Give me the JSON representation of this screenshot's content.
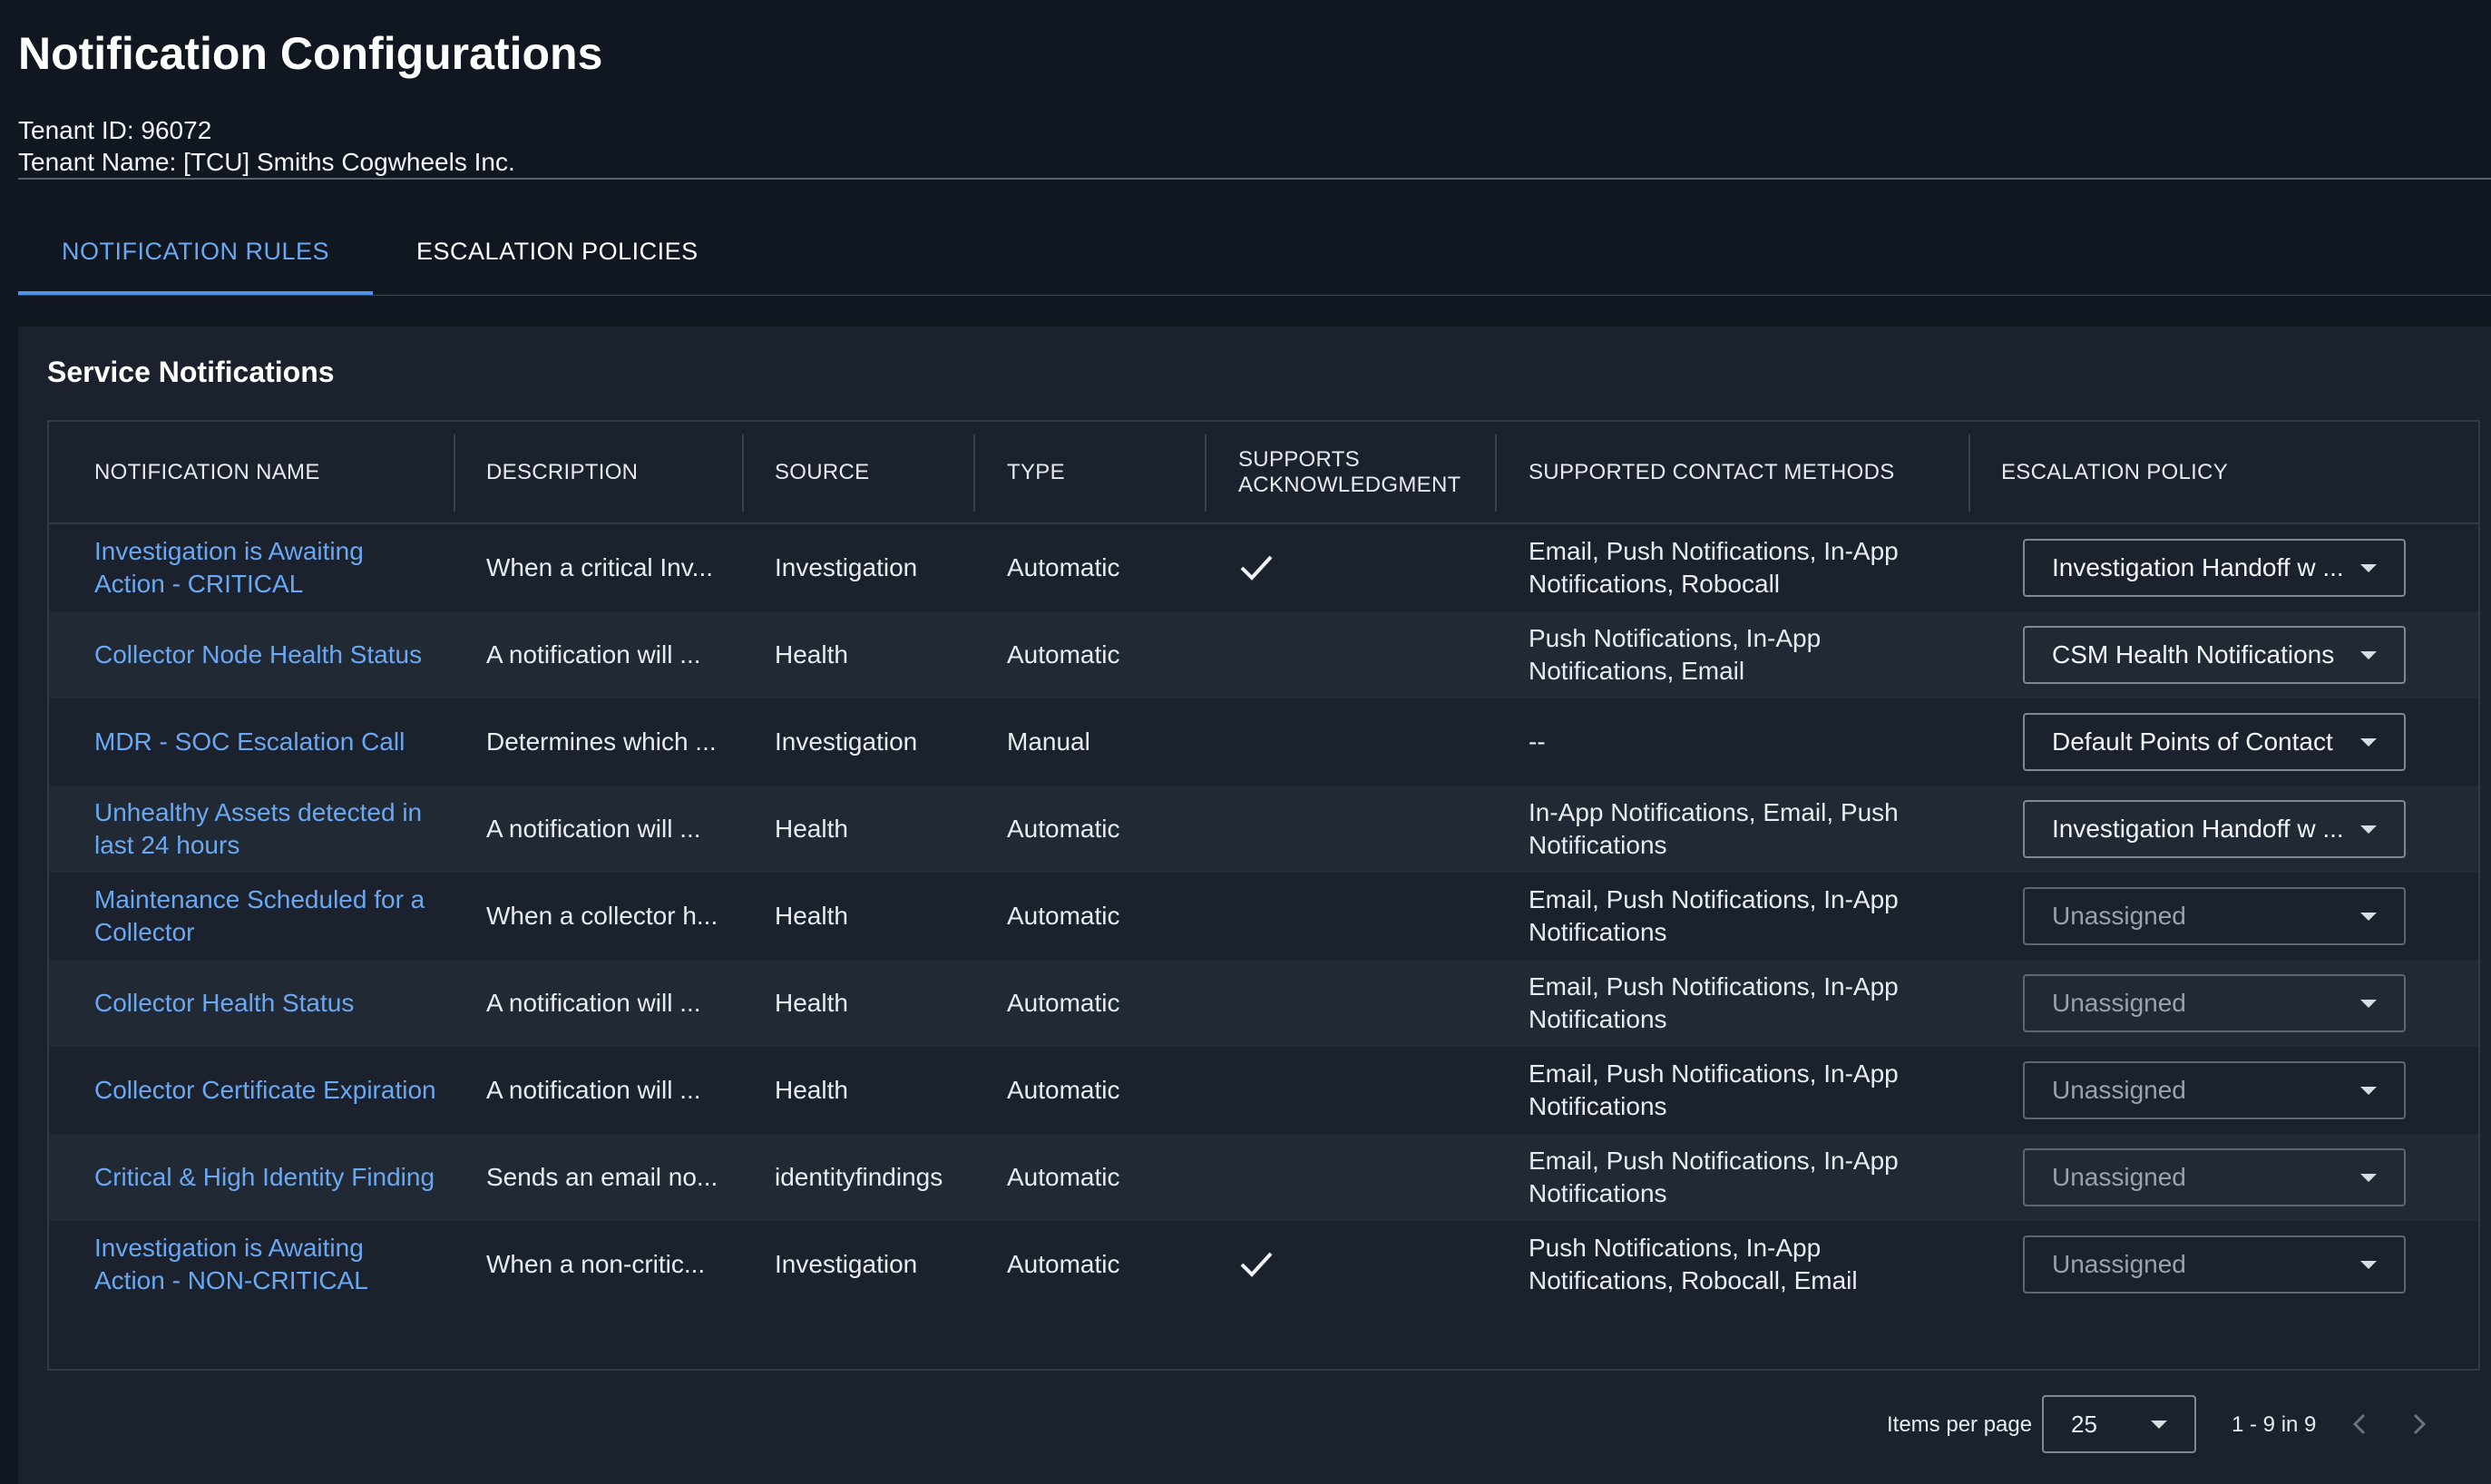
{
  "header": {
    "title": "Notification Configurations",
    "tenant_id": "Tenant ID: 96072",
    "tenant_name": "Tenant Name: [TCU] Smiths Cogwheels Inc."
  },
  "tabs": [
    {
      "label": "NOTIFICATION RULES",
      "active": true
    },
    {
      "label": "ESCALATION POLICIES",
      "active": false
    }
  ],
  "panel": {
    "title": "Service Notifications"
  },
  "table": {
    "columns": {
      "name": "NOTIFICATION NAME",
      "description": "DESCRIPTION",
      "source": "SOURCE",
      "type": "TYPE",
      "ack_line1": "SUPPORTS",
      "ack_line2": "ACKNOWLEDGMENT",
      "contact": "SUPPORTED CONTACT METHODS",
      "escalation": "ESCALATION POLICY"
    },
    "rows": [
      {
        "name": "Investigation is Awaiting Action - CRITICAL",
        "description": "When a critical Inv...",
        "source": "Investigation",
        "type": "Automatic",
        "ack": true,
        "contact": "Email, Push Notifications, In-App Notifications, Robocall",
        "escalation": "Investigation Handoff w ...",
        "assigned": true
      },
      {
        "name": "Collector Node Health Status",
        "description": "A notification will ...",
        "source": "Health",
        "type": "Automatic",
        "ack": false,
        "contact": "Push Notifications, In-App Notifications, Email",
        "escalation": "CSM Health Notifications",
        "assigned": true
      },
      {
        "name": "MDR - SOC Escalation Call",
        "description": "Determines which ...",
        "source": "Investigation",
        "type": "Manual",
        "ack": false,
        "contact": "--",
        "escalation": "Default Points of Contact",
        "assigned": true
      },
      {
        "name": "Unhealthy Assets detected in last 24 hours",
        "description": "A notification will ...",
        "source": "Health",
        "type": "Automatic",
        "ack": false,
        "contact": "In-App Notifications, Email, Push Notifications",
        "escalation": "Investigation Handoff w ...",
        "assigned": true
      },
      {
        "name": "Maintenance Scheduled for a Collector",
        "description": "When a collector h...",
        "source": "Health",
        "type": "Automatic",
        "ack": false,
        "contact": "Email, Push Notifications, In-App Notifications",
        "escalation": "Unassigned",
        "assigned": false
      },
      {
        "name": "Collector Health Status",
        "description": "A notification will ...",
        "source": "Health",
        "type": "Automatic",
        "ack": false,
        "contact": "Email, Push Notifications, In-App Notifications",
        "escalation": "Unassigned",
        "assigned": false
      },
      {
        "name": "Collector Certificate Expiration",
        "description": "A notification will ...",
        "source": "Health",
        "type": "Automatic",
        "ack": false,
        "contact": "Email, Push Notifications, In-App Notifications",
        "escalation": "Unassigned",
        "assigned": false
      },
      {
        "name": "Critical & High Identity Finding",
        "description": "Sends an email no...",
        "source": "identityfindings",
        "type": "Automatic",
        "ack": false,
        "contact": "Email, Push Notifications, In-App Notifications",
        "escalation": "Unassigned",
        "assigned": false
      },
      {
        "name": "Investigation is Awaiting Action - NON-CRITICAL",
        "description": "When a non-critic...",
        "source": "Investigation",
        "type": "Automatic",
        "ack": true,
        "contact": "Push Notifications, In-App Notifications, Robocall, Email",
        "escalation": "Unassigned",
        "assigned": false
      }
    ]
  },
  "pagination": {
    "items_per_page_label": "Items per page",
    "items_per_page_value": "25",
    "range": "1 - 9 in 9"
  },
  "colors": {
    "background": "#111720",
    "panel": "#1b222d",
    "link": "#6aa8f2",
    "active_tab_underline": "#4f93e6"
  },
  "icons": {
    "check": "checkmark-icon",
    "caret": "caret-down-icon",
    "prev": "chevron-left-icon",
    "next": "chevron-right-icon"
  }
}
